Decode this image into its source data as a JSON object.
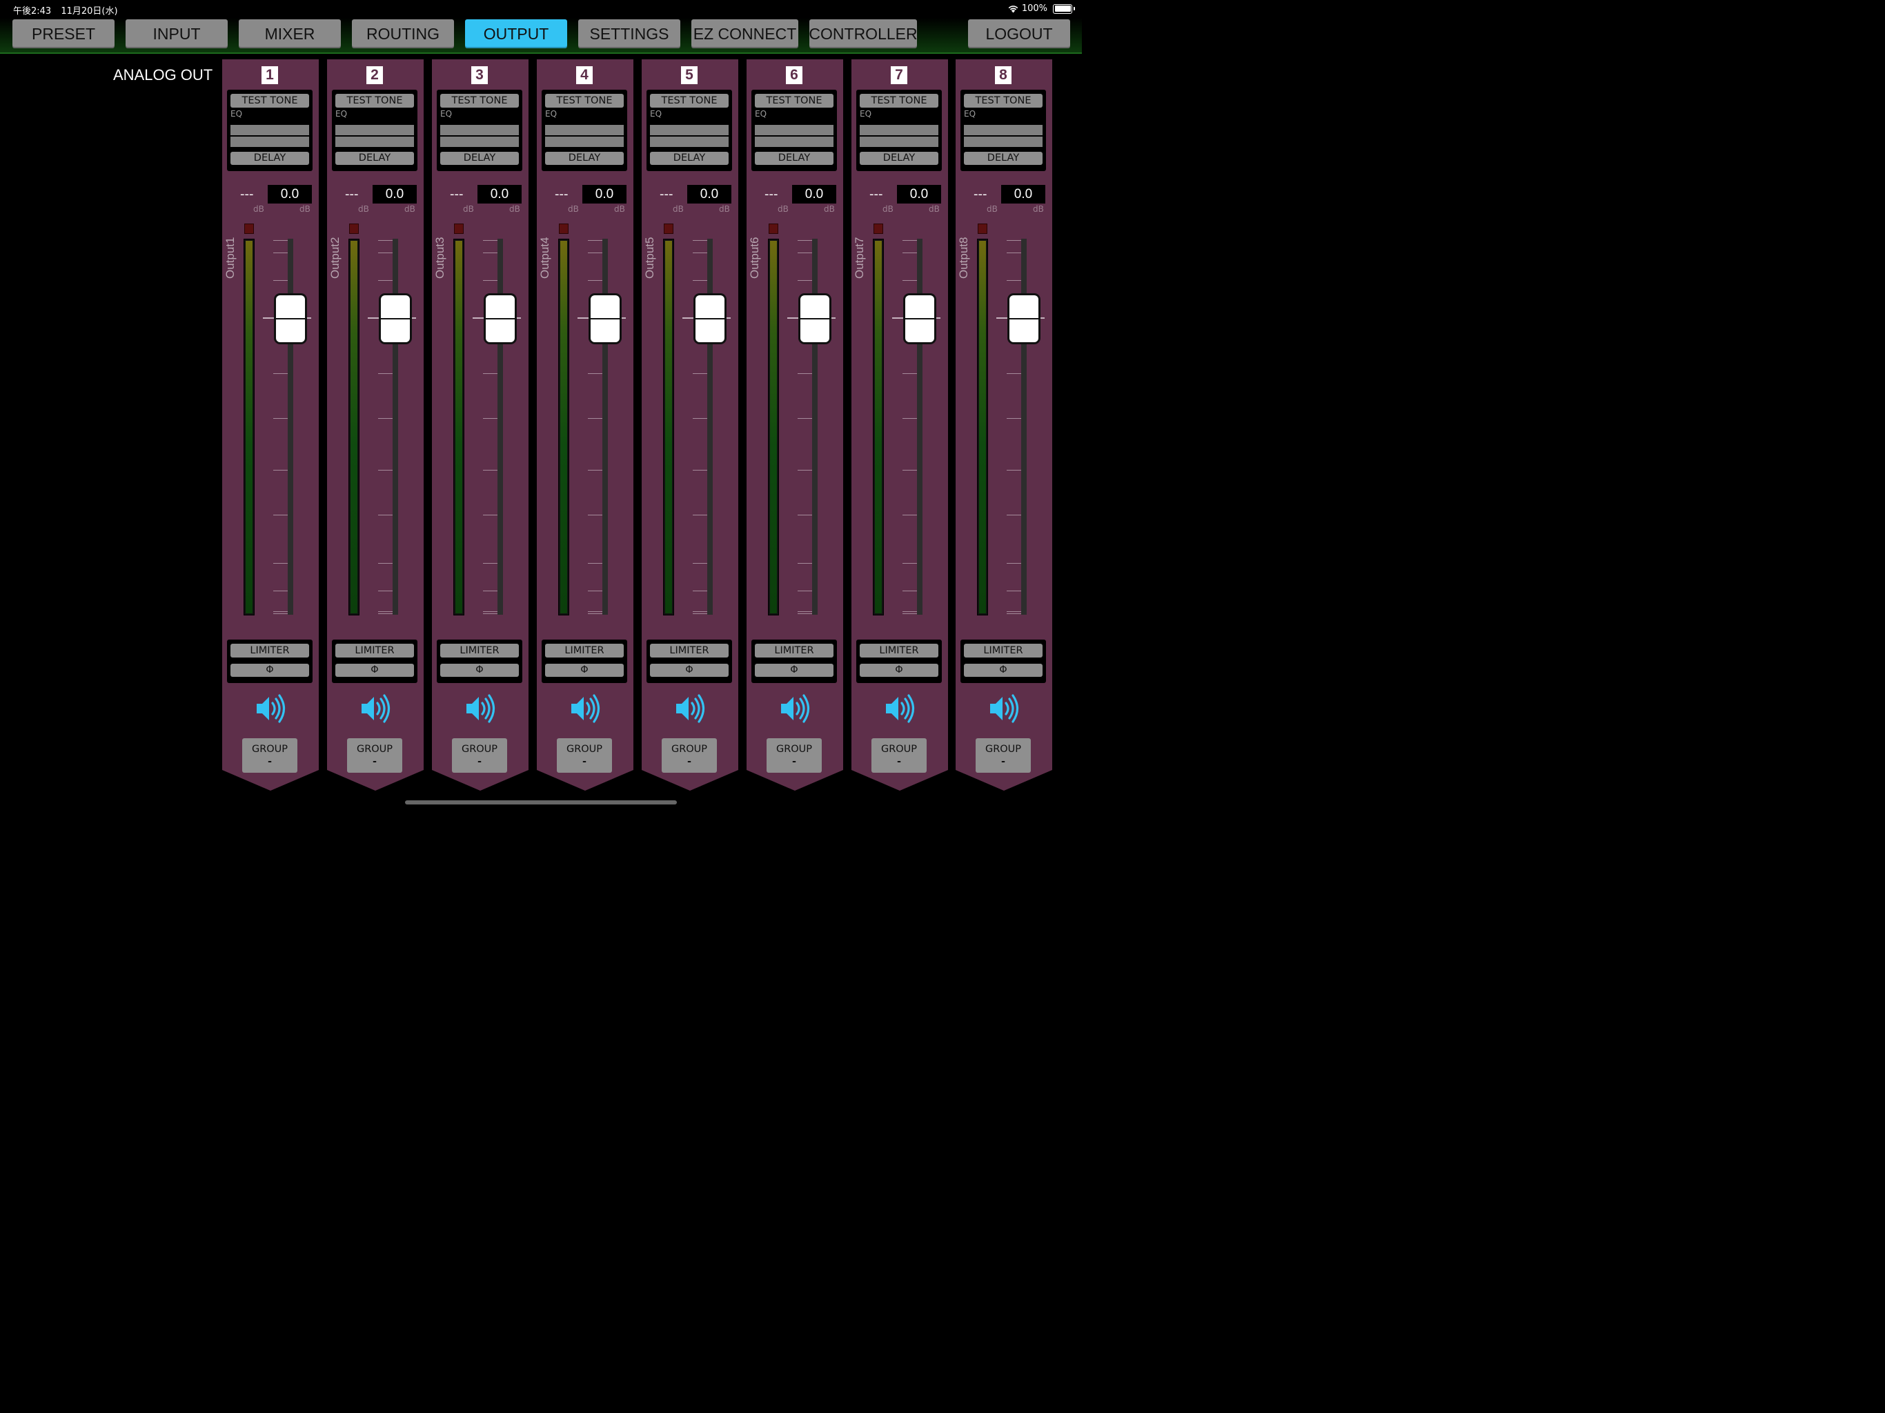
{
  "status_bar": {
    "time": "午後2:43",
    "date": "11月20日(水)",
    "battery": "100%"
  },
  "tabs": [
    {
      "label": "PRESET"
    },
    {
      "label": "INPUT"
    },
    {
      "label": "MIXER"
    },
    {
      "label": "ROUTING"
    },
    {
      "label": "OUTPUT"
    },
    {
      "label": "SETTINGS"
    },
    {
      "label": "EZ CONNECT"
    },
    {
      "label": "CONTROLLER"
    },
    {
      "label": "LOGOUT"
    }
  ],
  "active_tab": "OUTPUT",
  "section_title": "ANALOG OUT",
  "colors": {
    "strip": "#5e2f4a",
    "active_tab": "#33c3f3",
    "button": "#8f8f8f",
    "speaker": "#33c3f3"
  },
  "icons": {
    "mute": "speaker-icon",
    "wifi": "wifi-icon",
    "battery": "battery-icon"
  },
  "channel_template": {
    "test_tone": "TEST TONE",
    "eq": "EQ",
    "delay": "DELAY",
    "limiter": "LIMITER",
    "phase": "Φ",
    "group_label": "GROUP",
    "db_unit": "dB"
  },
  "channels": [
    {
      "number": "1",
      "name": "Output1",
      "meter_db": "---",
      "level_db": "0.0",
      "group": "-"
    },
    {
      "number": "2",
      "name": "Output2",
      "meter_db": "---",
      "level_db": "0.0",
      "group": "-"
    },
    {
      "number": "3",
      "name": "Output3",
      "meter_db": "---",
      "level_db": "0.0",
      "group": "-"
    },
    {
      "number": "4",
      "name": "Output4",
      "meter_db": "---",
      "level_db": "0.0",
      "group": "-"
    },
    {
      "number": "5",
      "name": "Output5",
      "meter_db": "---",
      "level_db": "0.0",
      "group": "-"
    },
    {
      "number": "6",
      "name": "Output6",
      "meter_db": "---",
      "level_db": "0.0",
      "group": "-"
    },
    {
      "number": "7",
      "name": "Output7",
      "meter_db": "---",
      "level_db": "0.0",
      "group": "-"
    },
    {
      "number": "8",
      "name": "Output8",
      "meter_db": "---",
      "level_db": "0.0",
      "group": "-"
    }
  ]
}
